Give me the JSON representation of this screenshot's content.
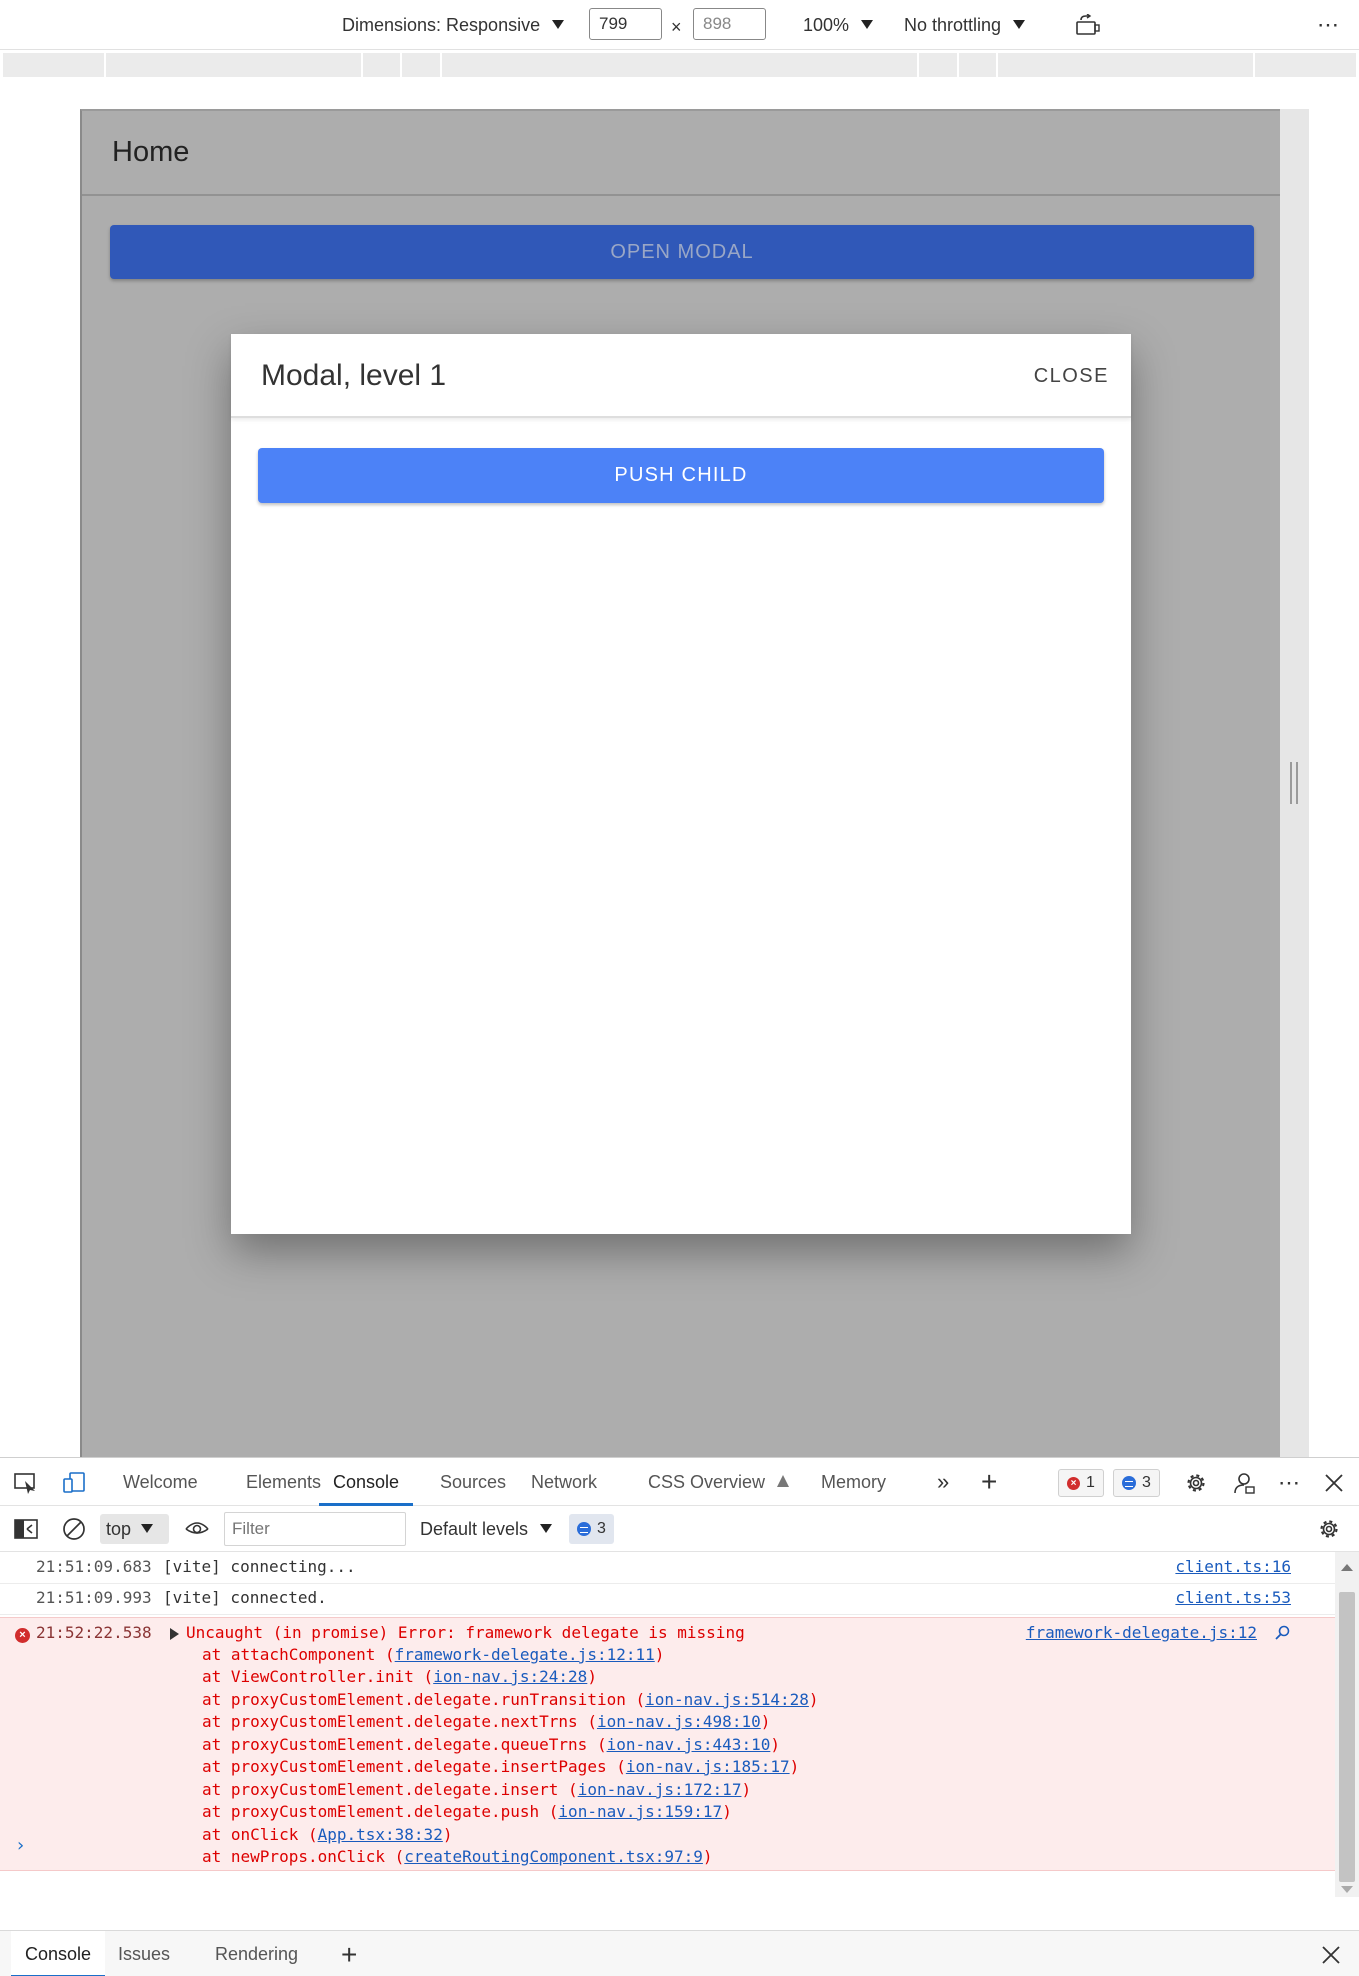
{
  "device_toolbar": {
    "dimensions_label": "Dimensions: Responsive",
    "width": "799",
    "height": "898",
    "times": "×",
    "zoom": "100%",
    "throttling": "No throttling"
  },
  "app": {
    "header_title": "Home",
    "open_modal_label": "OPEN MODAL"
  },
  "modal": {
    "title": "Modal, level 1",
    "close_label": "CLOSE",
    "push_child_label": "PUSH CHILD"
  },
  "devtools": {
    "tabs": [
      "Welcome",
      "Elements",
      "Console",
      "Sources",
      "Network",
      "CSS Overview",
      "Memory"
    ],
    "active_tab": "Console",
    "error_count": "1",
    "info_count": "3"
  },
  "console_toolbar": {
    "context": "top",
    "filter_placeholder": "Filter",
    "levels": "Default levels",
    "message_count": "3"
  },
  "console": {
    "lines": [
      {
        "ts": "21:51:09.683",
        "msg": "[vite] connecting...",
        "src": "client.ts:16"
      },
      {
        "ts": "21:51:09.993",
        "msg": "[vite] connected.",
        "src": "client.ts:53"
      }
    ],
    "error": {
      "ts": "21:52:22.538",
      "msg": "Uncaught (in promise) Error: framework delegate is missing",
      "src": "framework-delegate.js:12",
      "stack": [
        {
          "prefix": "at attachComponent (",
          "link": "framework-delegate.js:12:11",
          "suffix": ")"
        },
        {
          "prefix": "at ViewController.init (",
          "link": "ion-nav.js:24:28",
          "suffix": ")"
        },
        {
          "prefix": "at proxyCustomElement.delegate.runTransition (",
          "link": "ion-nav.js:514:28",
          "suffix": ")"
        },
        {
          "prefix": "at proxyCustomElement.delegate.nextTrns (",
          "link": "ion-nav.js:498:10",
          "suffix": ")"
        },
        {
          "prefix": "at proxyCustomElement.delegate.queueTrns (",
          "link": "ion-nav.js:443:10",
          "suffix": ")"
        },
        {
          "prefix": "at proxyCustomElement.delegate.insertPages (",
          "link": "ion-nav.js:185:17",
          "suffix": ")"
        },
        {
          "prefix": "at proxyCustomElement.delegate.insert (",
          "link": "ion-nav.js:172:17",
          "suffix": ")"
        },
        {
          "prefix": "at proxyCustomElement.delegate.push (",
          "link": "ion-nav.js:159:17",
          "suffix": ")"
        },
        {
          "prefix": "at onClick (",
          "link": "App.tsx:38:32",
          "suffix": ")"
        },
        {
          "prefix": "at newProps.onClick (",
          "link": "createRoutingComponent.tsx:97:9",
          "suffix": ")"
        }
      ]
    }
  },
  "drawer": {
    "tabs": [
      "Console",
      "Issues",
      "Rendering"
    ]
  },
  "colors": {
    "primary_button": "#4c82f7",
    "backdrop": "#adadad",
    "error_bg": "#fdecec",
    "link": "#1a5bbd",
    "accent_tab": "#1a6fc9"
  }
}
